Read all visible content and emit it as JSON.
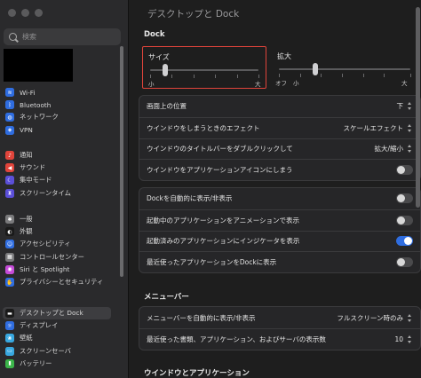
{
  "search": {
    "placeholder": "検索"
  },
  "sidebar": {
    "group1": [
      {
        "label": "Wi-Fi",
        "icon": "wifi-icon",
        "color": "#2f6de0"
      },
      {
        "label": "Bluetooth",
        "icon": "bluetooth-icon",
        "color": "#2f6de0"
      },
      {
        "label": "ネットワーク",
        "icon": "globe-icon",
        "color": "#2f6de0"
      },
      {
        "label": "VPN",
        "icon": "vpn-icon",
        "color": "#2f6de0"
      }
    ],
    "group2": [
      {
        "label": "通知",
        "icon": "bell-icon",
        "color": "#e0443b"
      },
      {
        "label": "サウンド",
        "icon": "speaker-icon",
        "color": "#e0443b"
      },
      {
        "label": "集中モード",
        "icon": "moon-icon",
        "color": "#5b4fd8"
      },
      {
        "label": "スクリーンタイム",
        "icon": "hourglass-icon",
        "color": "#5b4fd8"
      }
    ],
    "group3": [
      {
        "label": "一般",
        "icon": "gear-icon",
        "color": "#7a7a7c"
      },
      {
        "label": "外観",
        "icon": "appearance-icon",
        "color": "#1a1a1a"
      },
      {
        "label": "アクセシビリティ",
        "icon": "accessibility-icon",
        "color": "#2f6de0"
      },
      {
        "label": "コントロールセンター",
        "icon": "control-center-icon",
        "color": "#7a7a7c"
      },
      {
        "label": "Siri と Spotlight",
        "icon": "siri-icon",
        "color": "#c54bd8"
      },
      {
        "label": "プライバシーとセキュリティ",
        "icon": "hand-icon",
        "color": "#2f6de0"
      }
    ],
    "group4": [
      {
        "label": "デスクトップと Dock",
        "icon": "dock-icon",
        "color": "#1a1a1a",
        "selected": true
      },
      {
        "label": "ディスプレイ",
        "icon": "display-icon",
        "color": "#2f6de0"
      },
      {
        "label": "壁紙",
        "icon": "wallpaper-icon",
        "color": "#38a8e0"
      },
      {
        "label": "スクリーンセーバ",
        "icon": "screensaver-icon",
        "color": "#38a8e0"
      },
      {
        "label": "バッテリー",
        "icon": "battery-icon",
        "color": "#3bb54a"
      }
    ]
  },
  "main": {
    "title": "デスクトップと Dock",
    "dock_section": "Dock",
    "size": {
      "label": "サイズ",
      "min": "小",
      "max": "大",
      "value": 0.18
    },
    "magnify": {
      "label": "拡大",
      "off": "オフ",
      "min": "小",
      "max": "大",
      "value": 0.3
    },
    "panel1": [
      {
        "label": "画面上の位置",
        "value": "下"
      },
      {
        "label": "ウインドウをしまうときのエフェクト",
        "value": "スケールエフェクト"
      },
      {
        "label": "ウインドウのタイトルバーをダブルクリックして",
        "value": "拡大/縮小"
      },
      {
        "label": "ウインドウをアプリケーションアイコンにしまう",
        "toggle": false
      }
    ],
    "panel2": [
      {
        "label": "Dockを自動的に表示/非表示",
        "toggle": false
      },
      {
        "label": "起動中のアプリケーションをアニメーションで表示",
        "toggle": false
      },
      {
        "label": "起動済みのアプリケーションにインジケータを表示",
        "toggle": true
      },
      {
        "label": "最近使ったアプリケーションをDockに表示",
        "toggle": false
      }
    ],
    "menubar_section": "メニューバー",
    "panel3": [
      {
        "label": "メニューバーを自動的に表示/非表示",
        "value": "フルスクリーン時のみ"
      },
      {
        "label": "最近使った書類、アプリケーション、およびサーバの表示数",
        "value": "10"
      }
    ],
    "windows_section": "ウインドウとアプリケーション"
  },
  "highlight_color": "#e0443b"
}
